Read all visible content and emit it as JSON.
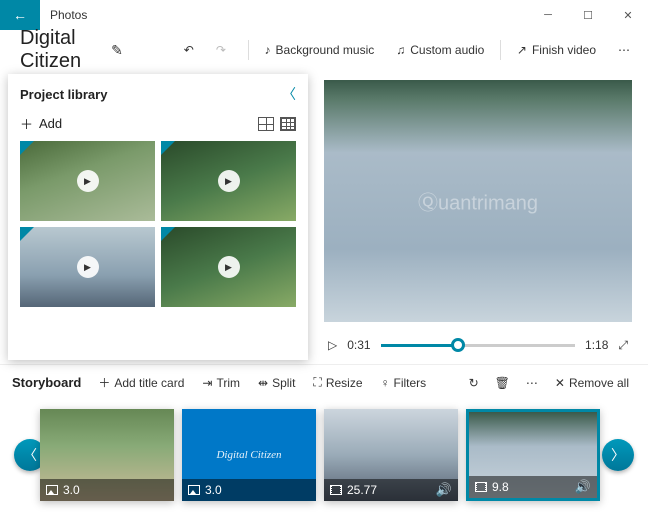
{
  "window": {
    "title": "Photos"
  },
  "project": {
    "name": "Digital Citizen"
  },
  "toolbar": {
    "background_music": "Background music",
    "custom_audio": "Custom audio",
    "finish_video": "Finish video"
  },
  "library": {
    "title": "Project library",
    "add": "Add"
  },
  "player": {
    "current": "0:31",
    "total": "1:18"
  },
  "storyboard": {
    "title": "Storyboard",
    "add_title": "Add title card",
    "trim": "Trim",
    "split": "Split",
    "resize": "Resize",
    "filters": "Filters",
    "remove_all": "Remove all"
  },
  "clips": [
    {
      "duration": "3.0"
    },
    {
      "duration": "3.0",
      "title_text": "Digital Citizen"
    },
    {
      "duration": "25.77"
    },
    {
      "duration": "9.8"
    }
  ],
  "watermark": "uantrimang"
}
